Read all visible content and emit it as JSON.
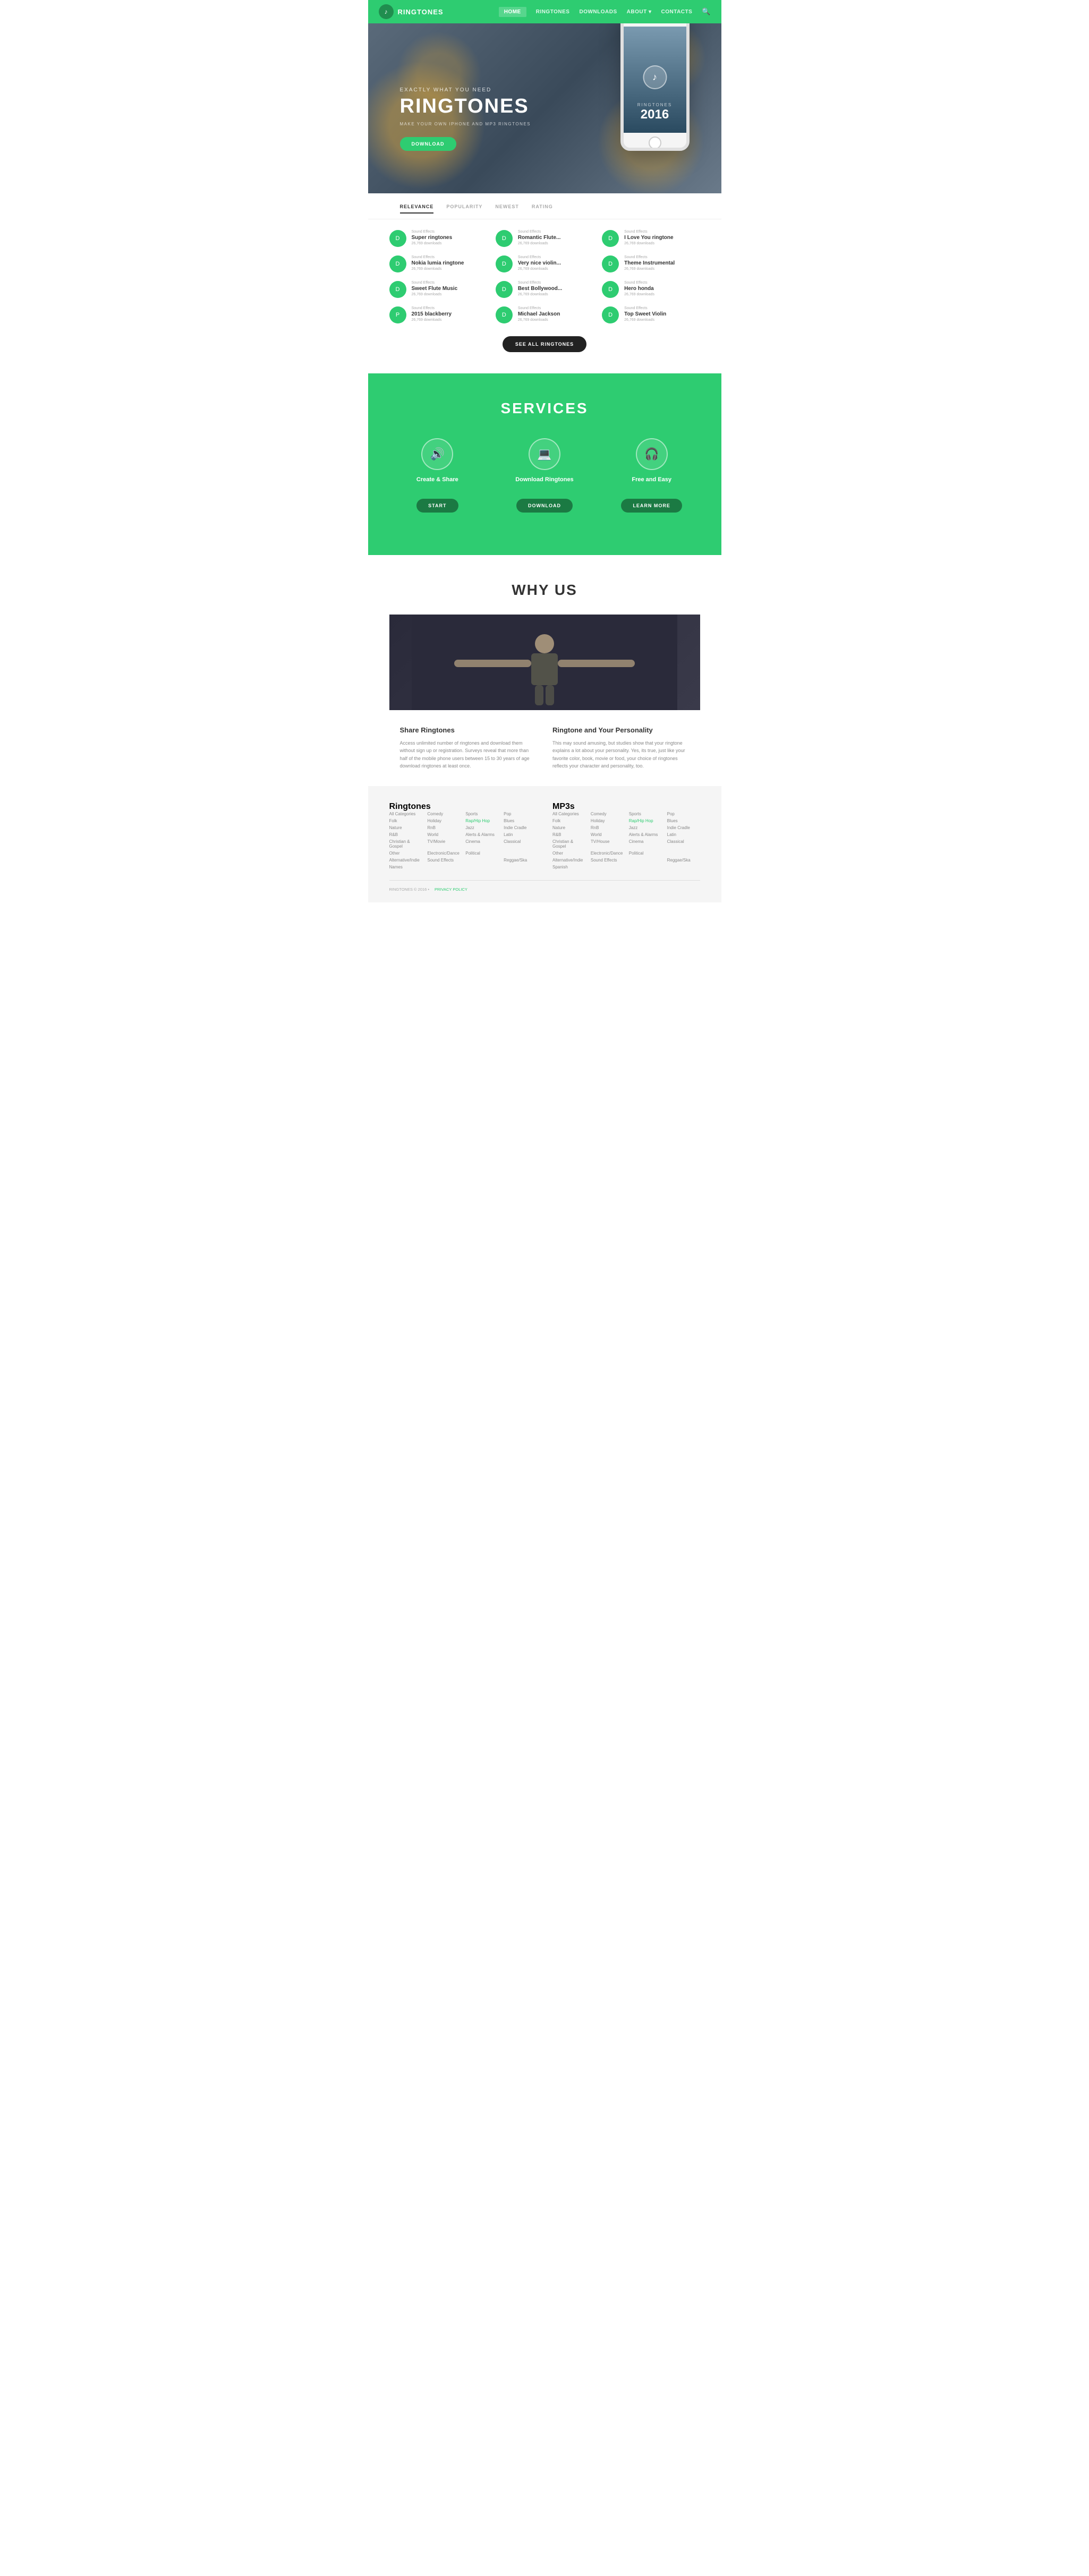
{
  "nav": {
    "logo_icon": "♪",
    "brand": "RINGTONES",
    "links": [
      {
        "label": "HOME",
        "active": true
      },
      {
        "label": "RINGTONES",
        "active": false
      },
      {
        "label": "DOWNLOADS",
        "active": false
      },
      {
        "label": "ABOUT ▾",
        "active": false
      },
      {
        "label": "CONTACTS",
        "active": false
      }
    ],
    "search_icon": "🔍"
  },
  "hero": {
    "subtitle": "Exactly what you need",
    "title": "RINGTONES",
    "description": "MAKE YOUR OWN IPHONE AND MP3 RINGTONES",
    "btn_label": "DOWNLOAD",
    "phone_label": "RINGTONES",
    "phone_year": "2016",
    "music_note": "♪"
  },
  "sort": {
    "items": [
      {
        "label": "RELEVANCE",
        "active": true
      },
      {
        "label": "POPULARITY",
        "active": false
      },
      {
        "label": "NEWEST",
        "active": false
      },
      {
        "label": "RATING",
        "active": false
      }
    ]
  },
  "ringtones": {
    "items": [
      {
        "icon": "D",
        "category": "Sound Effects",
        "name": "Super ringtones",
        "downloads": "26,769 downloads"
      },
      {
        "icon": "D",
        "category": "Sound Effects",
        "name": "Romantic Flute...",
        "downloads": "26,769 downloads"
      },
      {
        "icon": "D",
        "category": "Sound Effects",
        "name": "I Love You ringtone",
        "downloads": "26,769 downloads"
      },
      {
        "icon": "D",
        "category": "Sound Effects",
        "name": "Nokia lumia ringtone",
        "downloads": "26,769 downloads"
      },
      {
        "icon": "D",
        "category": "Sound Effects",
        "name": "Very nice violin...",
        "downloads": "26,769 downloads"
      },
      {
        "icon": "D",
        "category": "Sound Effects",
        "name": "Theme Instrumental",
        "downloads": "26,769 downloads"
      },
      {
        "icon": "D",
        "category": "Sound Effects",
        "name": "Sweet Flute Music",
        "downloads": "26,769 downloads"
      },
      {
        "icon": "D",
        "category": "Sound Effects",
        "name": "Best Bollywood...",
        "downloads": "26,769 downloads"
      },
      {
        "icon": "D",
        "category": "Sound Effects",
        "name": "Hero honda",
        "downloads": "26,769 downloads"
      },
      {
        "icon": "P",
        "category": "Sound Effects",
        "name": "2015 blackberry",
        "downloads": "26,769 downloads"
      },
      {
        "icon": "D",
        "category": "Sound Effects",
        "name": "Michael Jackson",
        "downloads": "26,769 downloads"
      },
      {
        "icon": "D",
        "category": "Sound Effects",
        "name": "Top Sweet Violin",
        "downloads": "26,769 downloads"
      }
    ],
    "see_all_label": "SEE ALL RINGTONES"
  },
  "services": {
    "title": "SERVICES",
    "items": [
      {
        "icon": "🔊",
        "name": "Create & Share",
        "btn_label": "START"
      },
      {
        "icon": "💻",
        "name": "Download Ringtones",
        "btn_label": "DOWNLOAD"
      },
      {
        "icon": "🎧",
        "name": "Free and Easy",
        "btn_label": "LEARN MORE"
      }
    ]
  },
  "why_us": {
    "title": "WHY US",
    "blocks": [
      {
        "title": "Share Ringtones",
        "text": "Access unlimited number of ringtones and download them without sign up or registration. Surveys reveal that more than half of the mobile phone users between 15 to 30 years of age download ringtones at least once."
      },
      {
        "title": "Ringtone and Your Personality",
        "text": "This may sound amusing, but studies show that your ringtone explains a lot about your personality. Yes, its true, just like your favorite color, book, movie or food, your choice of ringtones reflects your character and personality, too."
      }
    ]
  },
  "footer": {
    "ringtones_title": "Ringtones",
    "mp3s_title": "MP3s",
    "ringtone_links": [
      "All Categories",
      "Comedy",
      "Sports",
      "Pop",
      "Folk",
      "Holiday",
      "Rap/Hip Hop",
      "Blues",
      "Nature",
      "RnB",
      "Jazz",
      "Indie Cradle",
      "R&B",
      "World",
      "Alerts & Alarms",
      "Latin",
      "Christian & Gospel",
      "TV/Movie",
      "Cinema",
      "Classical",
      "Other",
      "Electronic/Dance",
      "Political",
      "",
      "Alternative/Indie",
      "Sound Effects",
      "",
      "Reggae/Ska",
      "Names",
      ""
    ],
    "mp3_links": [
      "All Categories",
      "Comedy",
      "Sports",
      "Pop",
      "Folk",
      "Holiday",
      "Rap/Hip Hop",
      "Blues",
      "Nature",
      "RnB",
      "Jazz",
      "Indie Cradle",
      "R&B",
      "World",
      "Alerts & Alarms",
      "Latin",
      "Christian & Gospel",
      "TV/House",
      "Cinema",
      "Classical",
      "Other",
      "Electronic/Dance",
      "Political",
      "",
      "Alternative/Indie",
      "Sound Effects",
      "",
      "Reggae/Ska",
      "Spanish",
      ""
    ],
    "copyright": "RINGTONES © 2016 •",
    "privacy": "PRIVACY POLICY"
  }
}
